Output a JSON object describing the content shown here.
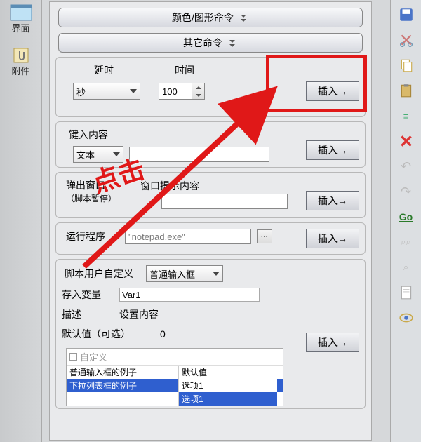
{
  "sidebar": {
    "interface_label": "界面",
    "attachment_label": "附件"
  },
  "headers": {
    "color_cmd": "颜色/图形命令",
    "other_cmd": "其它命令"
  },
  "delay": {
    "label_delay": "延时",
    "label_time": "时间",
    "unit": "秒",
    "value": "100",
    "insert": "插入→"
  },
  "keyin": {
    "title": "键入内容",
    "type": "文本",
    "insert": "插入→"
  },
  "popup": {
    "title": "弹出窗口",
    "subtitle": "（脚本暂停）",
    "hint_label": "窗口提示内容",
    "insert": "插入→"
  },
  "run": {
    "title": "运行程序",
    "value": "\"notepad.exe\"",
    "insert": "插入→"
  },
  "userdef": {
    "title": "脚本用户自定义",
    "type": "普通输入框",
    "var_label": "存入变量",
    "var_value": "Var1",
    "desc_label": "描述",
    "desc_value": "设置内容",
    "default_label": "默认值（可选）",
    "default_value": "0",
    "insert": "插入→",
    "tree_root": "自定义",
    "tree": [
      {
        "name": "普通输入框的例子",
        "val": "默认值"
      },
      {
        "name": "下拉列表框的例子",
        "val": "选项1"
      },
      {
        "name": "",
        "val": "选项1"
      }
    ]
  },
  "toolbar_go": "Go",
  "annotation": "点击"
}
